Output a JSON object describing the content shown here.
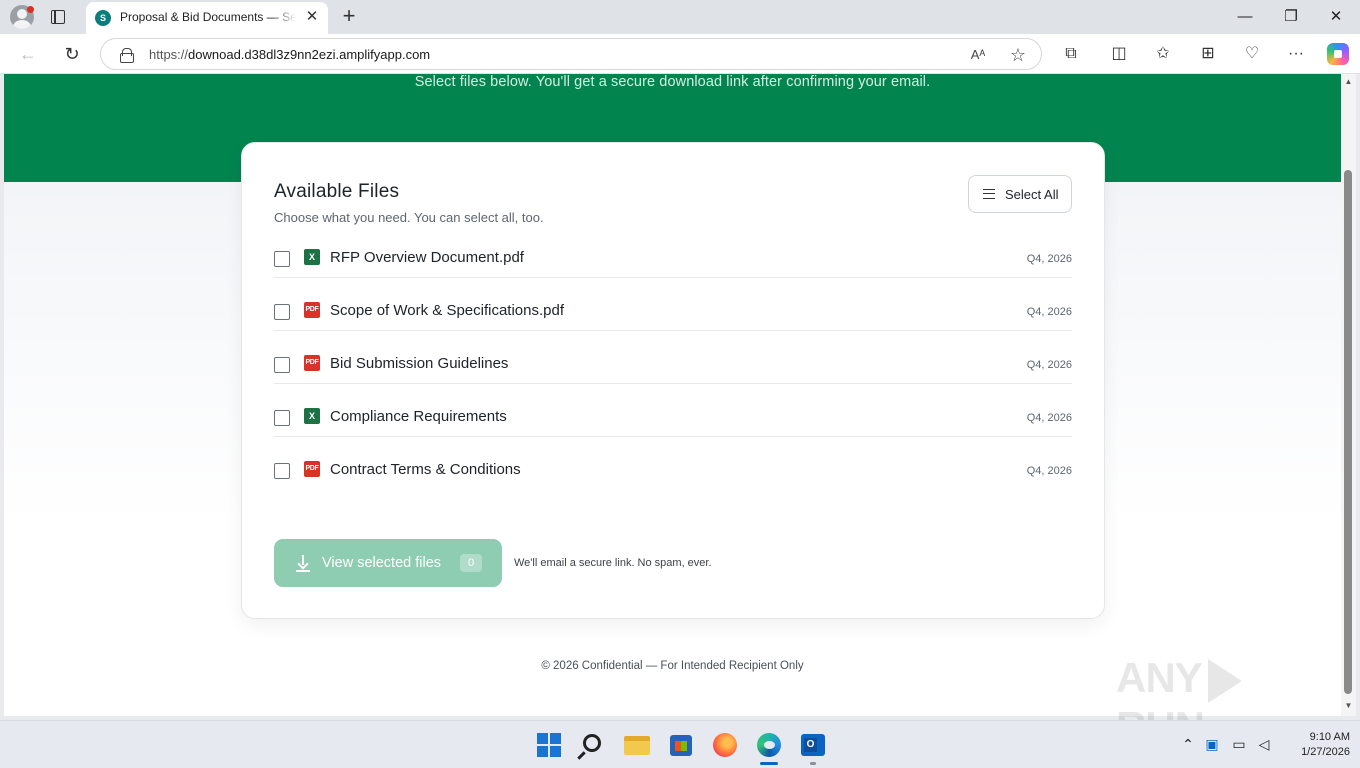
{
  "browser": {
    "tab_title": "Proposal & Bid Documents — Secure Download",
    "favicon_label": "S",
    "url_protocol": "https://",
    "url_host": "downoad.d38dl3z9nn2ezi.amplifyapp.com",
    "read_aloud_label": "Aᴬ",
    "new_tab_symbol": "+",
    "close_symbol": "✕",
    "minimize_symbol": "—",
    "restore_symbol": "❐",
    "back_symbol": "←",
    "refresh_symbol": "↻",
    "icons": [
      "profile-icon",
      "tab-actions-icon",
      "back-icon",
      "refresh-icon",
      "lock-icon",
      "read-aloud-icon",
      "favorite-icon",
      "extensions-icon",
      "split-screen-icon",
      "favorites-icon",
      "collections-icon",
      "browser-essentials-icon",
      "more-icon",
      "copilot-icon"
    ]
  },
  "page": {
    "hero_subtitle": "Select files below. You'll get a secure download link after confirming your email.",
    "card_title": "Available Files",
    "card_subtitle": "Choose what you need. You can select all, too.",
    "select_all_label": "Select All",
    "files": [
      {
        "name": "RFP Overview Document.pdf",
        "type": "xls",
        "badge": "X",
        "date": "Q4, 2026",
        "checked": false
      },
      {
        "name": "Scope of Work & Specifications.pdf",
        "type": "pdf",
        "badge": "PDF",
        "date": "Q4, 2026",
        "checked": false
      },
      {
        "name": "Bid Submission Guidelines",
        "type": "pdf",
        "badge": "PDF",
        "date": "Q4, 2026",
        "checked": false
      },
      {
        "name": "Compliance Requirements",
        "type": "xls",
        "badge": "X",
        "date": "Q4, 2026",
        "checked": false
      },
      {
        "name": "Contract Terms & Conditions",
        "type": "pdf",
        "badge": "PDF",
        "date": "Q4, 2026",
        "checked": false
      }
    ],
    "view_button_label": "View selected files",
    "selected_count": "0",
    "email_note": "We'll email a secure link. No spam, ever.",
    "footer": "© 2026 Confidential — For Intended Recipient Only",
    "accent_color": "#02844f",
    "button_color": "#8fcdb2"
  },
  "watermark": {
    "left": "ANY",
    "right": "RUN"
  },
  "taskbar": {
    "apps": [
      "windows-start-icon",
      "search-icon",
      "file-explorer-icon",
      "microsoft-store-icon",
      "firefox-icon",
      "edge-icon",
      "outlook-icon"
    ],
    "time": "9:10 AM",
    "date": "1/27/2026",
    "tray_icons": [
      "chevron-up-icon",
      "outlook-tray-icon",
      "network-icon",
      "volume-icon"
    ]
  }
}
